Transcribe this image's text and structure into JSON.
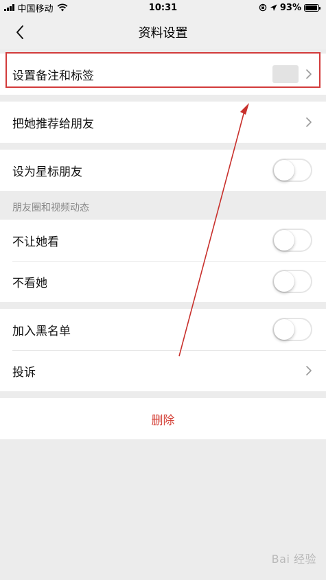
{
  "status": {
    "carrier": "中国移动",
    "time": "10:31",
    "battery": "93%",
    "battery_level": 0.93,
    "icons": [
      "signal-icon",
      "wifi-icon",
      "orientation-lock-icon",
      "location-icon",
      "battery-icon"
    ]
  },
  "nav": {
    "title": "资料设置",
    "back_icon": "chevron-left-icon"
  },
  "rows": {
    "remark": "设置备注和标签",
    "recommend": "把她推荐给朋友",
    "star": "设为星标朋友",
    "moments_header": "朋友圈和视频动态",
    "hide_mine": "不让她看",
    "hide_hers": "不看她",
    "blacklist": "加入黑名单",
    "complain": "投诉"
  },
  "toggles": {
    "star": false,
    "hide_mine": false,
    "hide_hers": false,
    "blacklist": false
  },
  "delete_label": "删除",
  "watermark": "Bai 经验",
  "colors": {
    "danger": "#d5443b",
    "highlight_border": "#d23a3a",
    "annotation_arrow": "#c8302c"
  }
}
